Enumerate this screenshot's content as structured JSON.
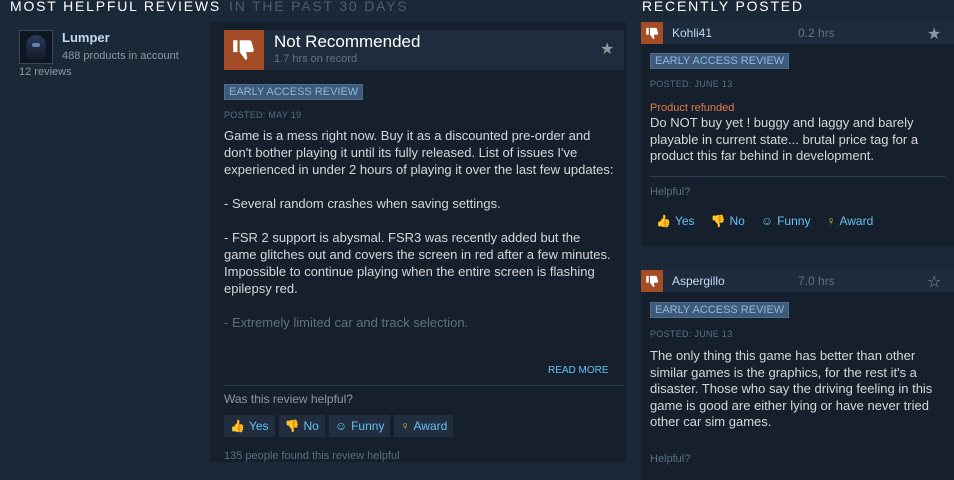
{
  "headers": {
    "most_helpful": "MOST HELPFUL REVIEWS",
    "past_30": "IN THE PAST 30 DAYS",
    "recently_posted": "RECENTLY POSTED"
  },
  "main_review": {
    "author": {
      "name": "Lumper",
      "products": "488 products in account",
      "reviews": "12 reviews"
    },
    "verdict": "Not Recommended",
    "hours": "1.7 hrs on record",
    "badge": "EARLY ACCESS REVIEW",
    "posted": "POSTED: MAY 19",
    "paragraphs": [
      "Game is a mess right now. Buy it as a discounted pre-order and don't bother playing it until its fully released. List of issues I've experienced in under 2 hours of playing it over the last few updates:",
      "- Several random crashes when saving settings.",
      "- FSR 2 support is abysmal. FSR3 was recently added but the game glitches out and covers the screen in red after a few minutes. Impossible to continue playing when the entire screen is flashing epilepsy red.",
      "- Extremely limited car and track selection."
    ],
    "read_more": "READ MORE",
    "helpful_question": "Was this review helpful?",
    "buttons": {
      "yes": "Yes",
      "no": "No",
      "funny": "Funny",
      "award": "Award"
    },
    "found_helpful": "135 people found this review helpful"
  },
  "recent": [
    {
      "user": "Kohli41",
      "hours": "0.2 hrs",
      "badge": "EARLY ACCESS REVIEW",
      "posted": "POSTED: JUNE 13",
      "refunded": "Product refunded",
      "text": "Do NOT buy yet ! buggy and laggy and barely playable in current state... brutal price tag for a product this far behind in development.",
      "helpful": "Helpful?",
      "buttons": {
        "yes": "Yes",
        "no": "No",
        "funny": "Funny",
        "award": "Award"
      }
    },
    {
      "user": "Aspergillo",
      "hours": "7.0 hrs",
      "badge": "EARLY ACCESS REVIEW",
      "posted": "POSTED: JUNE 13",
      "text": "The only thing this game has better than other similar games is the graphics, for the rest it's a disaster. Those who say the driving feeling in this game is good are either lying or have never tried other car sim games.",
      "helpful": "Helpful?"
    }
  ],
  "colors": {
    "accent": "#66c0f4",
    "thumb_down_bg": "#a34c25",
    "background": "#1b2838"
  }
}
